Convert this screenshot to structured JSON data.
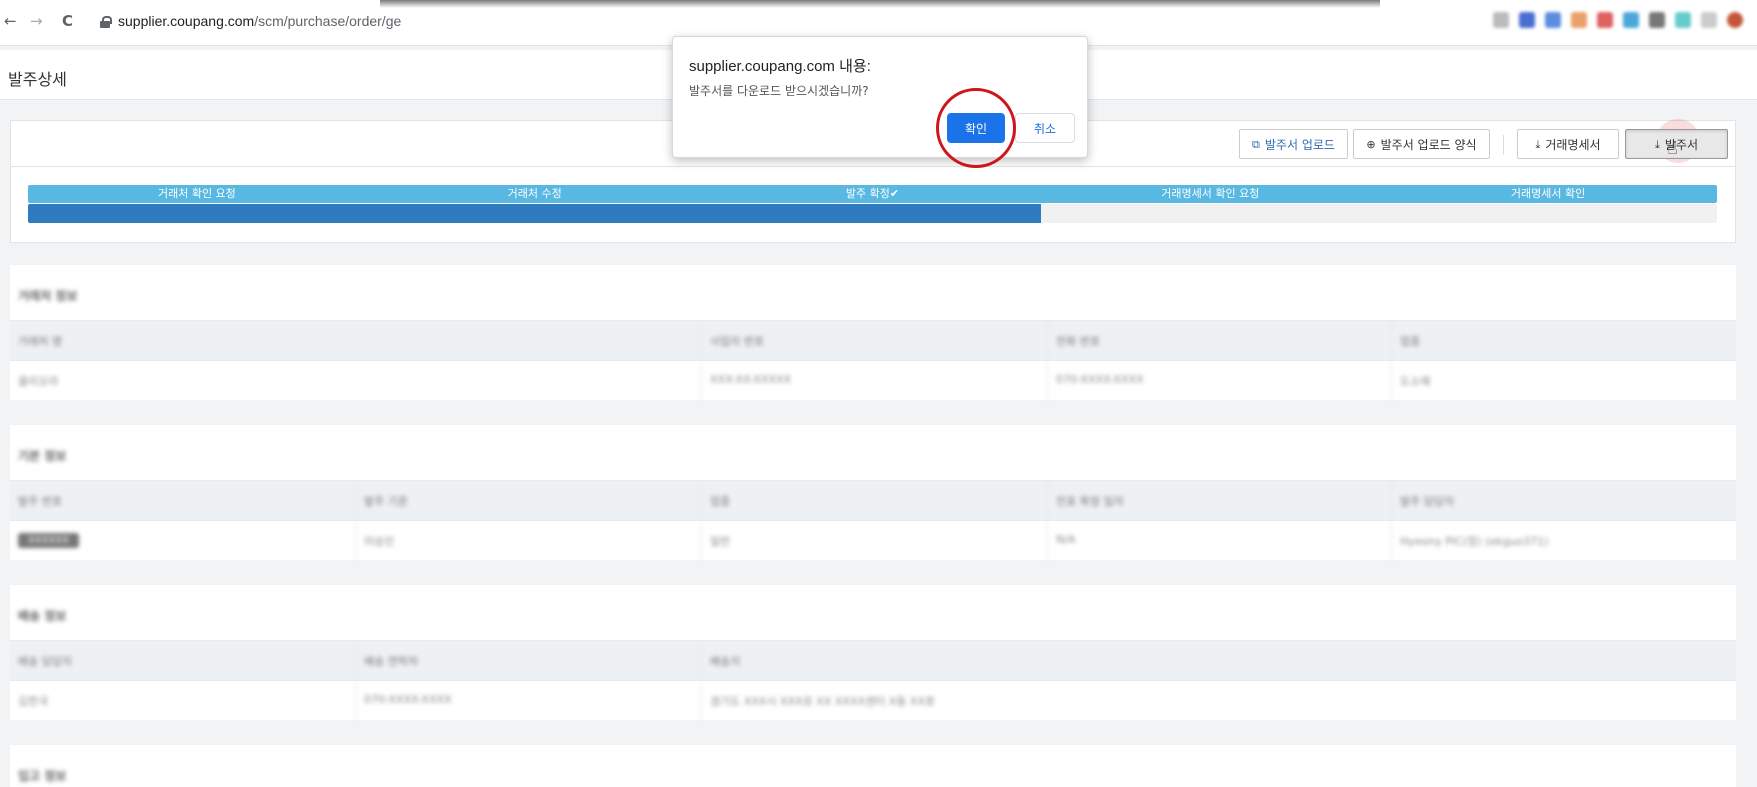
{
  "browser": {
    "url_host": "supplier.coupang.com",
    "url_path": "/scm/purchase/order/ge",
    "back": "←",
    "forward": "→",
    "reload": "C"
  },
  "page": {
    "title": "발주상세"
  },
  "toolbar": {
    "upload_label": "발주서 업로드",
    "upload_form_label": "발주서 업로드 양식",
    "statement_label": "거래명세서",
    "po_label": "발주서"
  },
  "status": {
    "steps": [
      "거래처 확인 요청",
      "거래처 수정",
      "발주 확정✔",
      "거래명세서 확인 요청",
      "거래명세서 확인"
    ],
    "progress_fraction": 0.6
  },
  "dialog": {
    "title": "supplier.coupang.com 내용:",
    "message": "발주서를 다운로드 받으시겠습니까?",
    "ok_label": "확인",
    "cancel_label": "취소"
  },
  "sections": [
    {
      "title": "거래처 정보",
      "headers": [
        "거래처 명",
        "사업자 번호",
        "전화 번호",
        "업종"
      ],
      "rows": [
        [
          "클리오라",
          "XXX-XX-XXXXX",
          "070-XXXX-XXXX",
          "도소매"
        ]
      ]
    },
    {
      "title": "기본 정보",
      "headers": [
        "발주 번호",
        "발주 기준",
        "업종",
        "전표 확정 일자",
        "발주 담당자"
      ],
      "rows": [
        [
          "XXXXXX",
          "미승인",
          "일반",
          "N/A",
          "Hyeony PIC(정) (ekguo371)"
        ]
      ]
    },
    {
      "title": "배송 정보",
      "headers": [
        "배송 담당자",
        "배송 연락처",
        "배송지"
      ],
      "rows": [
        [
          "김한국",
          "070-XXXX-XXXX",
          "경기도 XXX시 XXX로 XX XXXX센터 X동 XX호"
        ]
      ]
    },
    {
      "title": "입고 정보",
      "headers": [],
      "rows": []
    }
  ]
}
